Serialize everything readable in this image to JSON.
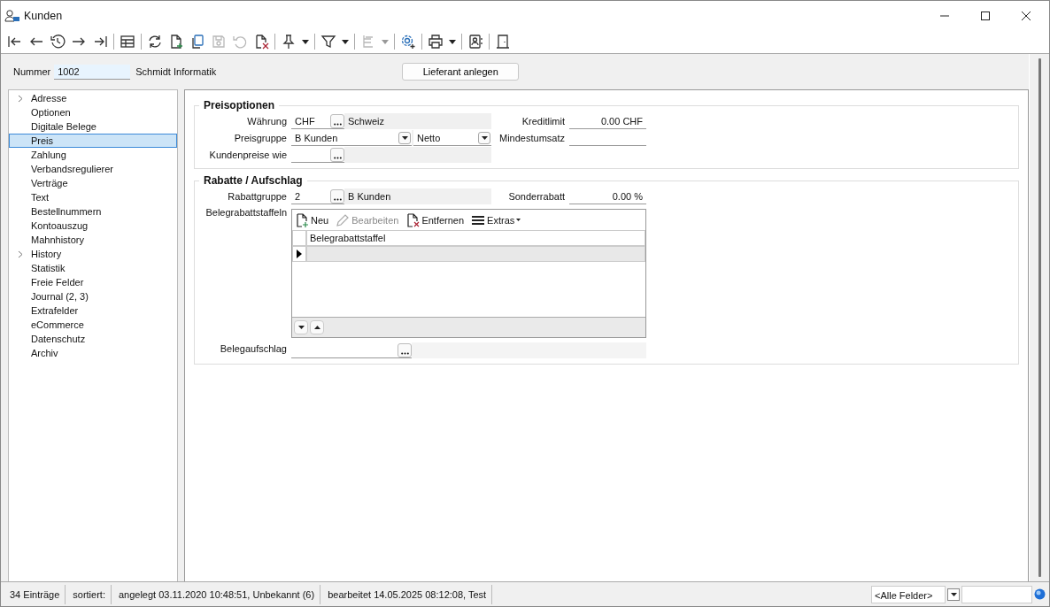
{
  "window": {
    "title": "Kunden"
  },
  "toolbar": [
    {
      "kind": "first",
      "disabled": false,
      "dropdown": false
    },
    {
      "kind": "back",
      "disabled": false,
      "dropdown": false
    },
    {
      "kind": "history",
      "disabled": false,
      "dropdown": false
    },
    {
      "kind": "forward",
      "disabled": false,
      "dropdown": false
    },
    {
      "kind": "last",
      "disabled": false,
      "dropdown": false
    },
    {
      "kind": "separator"
    },
    {
      "kind": "table",
      "disabled": false,
      "dropdown": false
    },
    {
      "kind": "separator"
    },
    {
      "kind": "refresh",
      "disabled": false,
      "dropdown": false
    },
    {
      "kind": "new",
      "disabled": false,
      "dropdown": false
    },
    {
      "kind": "copy",
      "disabled": false,
      "dropdown": false
    },
    {
      "kind": "save",
      "disabled": true,
      "dropdown": false
    },
    {
      "kind": "undo",
      "disabled": true,
      "dropdown": false
    },
    {
      "kind": "delete",
      "disabled": false,
      "dropdown": false
    },
    {
      "kind": "separator"
    },
    {
      "kind": "pin",
      "disabled": false,
      "dropdown": true
    },
    {
      "kind": "separator"
    },
    {
      "kind": "filter",
      "disabled": false,
      "dropdown": true
    },
    {
      "kind": "separator"
    },
    {
      "kind": "tree",
      "disabled": true,
      "dropdown": true
    },
    {
      "kind": "separator"
    },
    {
      "kind": "settings",
      "disabled": false,
      "dropdown": false
    },
    {
      "kind": "separator"
    },
    {
      "kind": "print",
      "disabled": false,
      "dropdown": true
    },
    {
      "kind": "separator"
    },
    {
      "kind": "contact",
      "disabled": false,
      "dropdown": false
    },
    {
      "kind": "separator"
    },
    {
      "kind": "exit",
      "disabled": false,
      "dropdown": false
    }
  ],
  "header": {
    "number_label": "Nummer",
    "number_value": "1002",
    "name": "Schmidt Informatik",
    "button": "Lieferant anlegen"
  },
  "sidebar": {
    "items": [
      {
        "label": "Adresse",
        "selected": false,
        "collapsed": true
      },
      {
        "label": "Optionen",
        "selected": false,
        "collapsed": false
      },
      {
        "label": "Digitale Belege",
        "selected": false,
        "collapsed": false
      },
      {
        "label": "Preis",
        "selected": true,
        "collapsed": false
      },
      {
        "label": "Zahlung",
        "selected": false,
        "collapsed": false
      },
      {
        "label": "Verbandsregulierer",
        "selected": false,
        "collapsed": false
      },
      {
        "label": "Verträge",
        "selected": false,
        "collapsed": false
      },
      {
        "label": "Text",
        "selected": false,
        "collapsed": false
      },
      {
        "label": "Bestellnummern",
        "selected": false,
        "collapsed": false
      },
      {
        "label": "Kontoauszug",
        "selected": false,
        "collapsed": false
      },
      {
        "label": "Mahnhistory",
        "selected": false,
        "collapsed": false
      },
      {
        "label": "History",
        "selected": false,
        "collapsed": true
      },
      {
        "label": "Statistik",
        "selected": false,
        "collapsed": false
      },
      {
        "label": "Freie Felder",
        "selected": false,
        "collapsed": false
      },
      {
        "label": "Journal (2, 3)",
        "selected": false,
        "collapsed": false
      },
      {
        "label": "Extrafelder",
        "selected": false,
        "collapsed": false
      },
      {
        "label": "eCommerce",
        "selected": false,
        "collapsed": false
      },
      {
        "label": "Datenschutz",
        "selected": false,
        "collapsed": false
      },
      {
        "label": "Archiv",
        "selected": false,
        "collapsed": false
      }
    ]
  },
  "preisoptionen": {
    "title": "Preisoptionen",
    "waehrung": {
      "label": "Währung",
      "value": "CHF",
      "description": "Schweiz"
    },
    "preisgruppe": {
      "label": "Preisgruppe",
      "value": "B Kunden",
      "mode": "Netto"
    },
    "kundenpreise": {
      "label": "Kundenpreise wie"
    },
    "kreditlimit": {
      "label": "Kreditlimit",
      "value": "0.00 CHF"
    },
    "mindestumsatz": {
      "label": "Mindestumsatz"
    }
  },
  "rabatte": {
    "title": "Rabatte / Aufschlag",
    "rabattgruppe": {
      "label": "Rabattgruppe",
      "value": "2",
      "description": "B Kunden"
    },
    "sonderrabatt": {
      "label": "Sonderrabatt",
      "value": "0.00 %"
    },
    "staffeln": {
      "label": "Belegrabattstaffeln",
      "actions": [
        {
          "kind": "new",
          "label": "Neu",
          "disabled": false
        },
        {
          "kind": "edit",
          "label": "Bearbeiten",
          "disabled": true
        },
        {
          "kind": "remove",
          "label": "Entfernen",
          "disabled": false
        },
        {
          "kind": "menu",
          "label": "Extras",
          "disabled": false
        }
      ],
      "column": "Belegrabattstaffel"
    },
    "belegaufschlag": {
      "label": "Belegaufschlag"
    }
  },
  "status_bar": {
    "items": [
      "34 Einträge",
      "sortiert:",
      "angelegt 03.11.2020 10:48:51, Unbekannt (6)",
      "bearbeitet 14.05.2025 08:12:08, Test"
    ],
    "filter": "<Alle Felder>"
  }
}
